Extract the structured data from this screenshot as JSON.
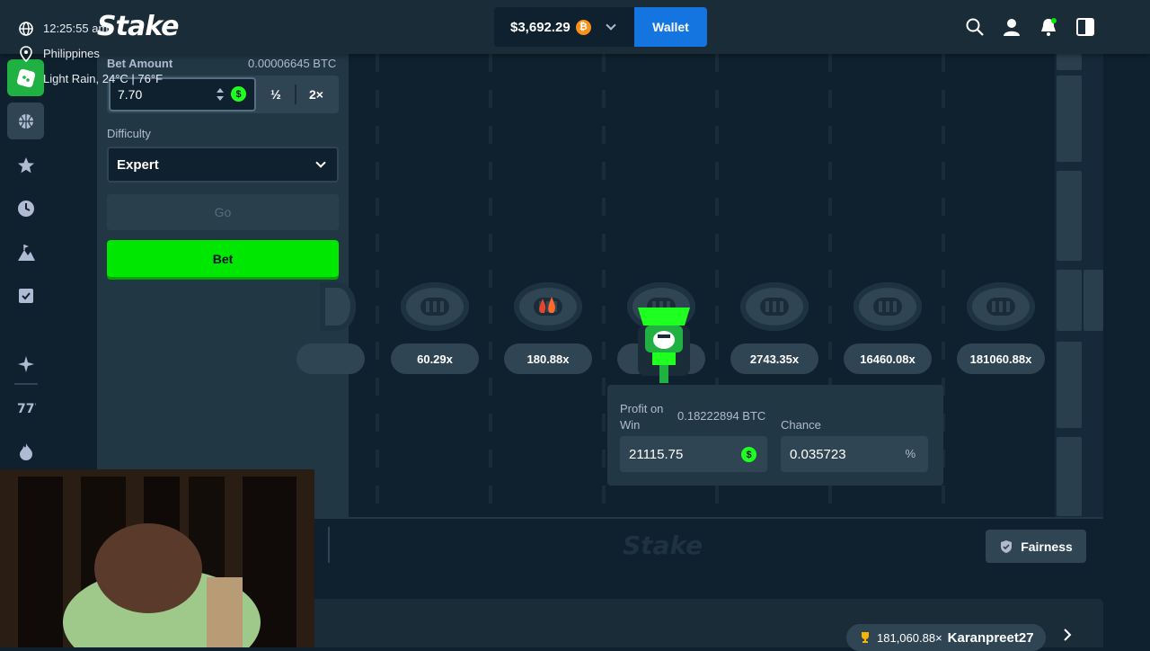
{
  "overlay": {
    "time": "12:25:55 am",
    "location": "Philippines",
    "weather": "Light Rain, 24°C | 76°F"
  },
  "header": {
    "logo": "Stake",
    "balance": "$3,692.29",
    "currency_symbol": "₿",
    "wallet_label": "Wallet"
  },
  "bet_panel": {
    "bet_amount_label": "Bet Amount",
    "bet_amount_btc": "0.00006645 BTC",
    "bet_amount_value": "7.70",
    "half_label": "½",
    "double_label": "2×",
    "difficulty_label": "Difficulty",
    "difficulty_value": "Expert",
    "go_label": "Go",
    "bet_label": "Bet"
  },
  "game": {
    "multipliers": [
      "60.29x",
      "180.88x",
      "2743.35x",
      "16460.08x",
      "181060.88x"
    ],
    "profit_label": "Profit on Win",
    "profit_btc": "0.18222894 BTC",
    "profit_value": "21115.75",
    "chance_label": "Chance",
    "chance_value": "0.035723",
    "chance_unit": "%"
  },
  "footer": {
    "watermark": "Stake",
    "fairness_label": "Fairness",
    "winner_multiplier": "181,060.88×",
    "winner_name": "Karanpreet27"
  },
  "colors": {
    "accent_green": "#00e701",
    "wallet_blue": "#1475e1",
    "panel": "#213743",
    "background": "#0f212e"
  }
}
